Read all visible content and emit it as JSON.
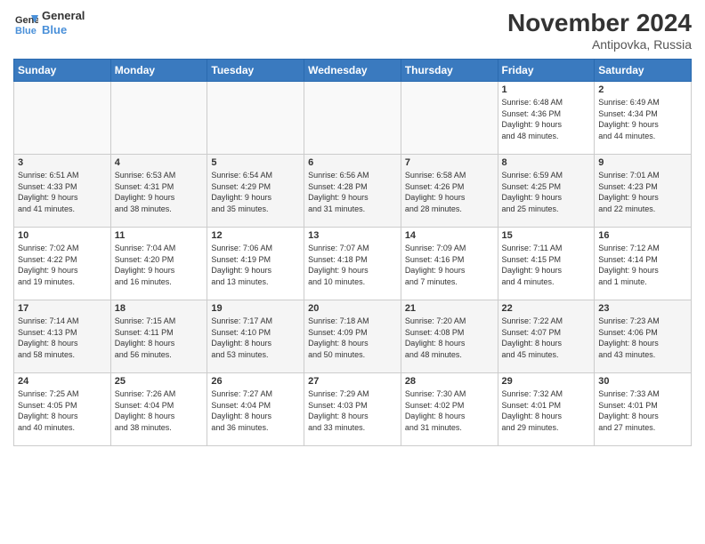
{
  "logo": {
    "line1": "General",
    "line2": "Blue"
  },
  "title": "November 2024",
  "location": "Antipovka, Russia",
  "days_header": [
    "Sunday",
    "Monday",
    "Tuesday",
    "Wednesday",
    "Thursday",
    "Friday",
    "Saturday"
  ],
  "weeks": [
    [
      {
        "day": "",
        "info": ""
      },
      {
        "day": "",
        "info": ""
      },
      {
        "day": "",
        "info": ""
      },
      {
        "day": "",
        "info": ""
      },
      {
        "day": "",
        "info": ""
      },
      {
        "day": "1",
        "info": "Sunrise: 6:48 AM\nSunset: 4:36 PM\nDaylight: 9 hours\nand 48 minutes."
      },
      {
        "day": "2",
        "info": "Sunrise: 6:49 AM\nSunset: 4:34 PM\nDaylight: 9 hours\nand 44 minutes."
      }
    ],
    [
      {
        "day": "3",
        "info": "Sunrise: 6:51 AM\nSunset: 4:33 PM\nDaylight: 9 hours\nand 41 minutes."
      },
      {
        "day": "4",
        "info": "Sunrise: 6:53 AM\nSunset: 4:31 PM\nDaylight: 9 hours\nand 38 minutes."
      },
      {
        "day": "5",
        "info": "Sunrise: 6:54 AM\nSunset: 4:29 PM\nDaylight: 9 hours\nand 35 minutes."
      },
      {
        "day": "6",
        "info": "Sunrise: 6:56 AM\nSunset: 4:28 PM\nDaylight: 9 hours\nand 31 minutes."
      },
      {
        "day": "7",
        "info": "Sunrise: 6:58 AM\nSunset: 4:26 PM\nDaylight: 9 hours\nand 28 minutes."
      },
      {
        "day": "8",
        "info": "Sunrise: 6:59 AM\nSunset: 4:25 PM\nDaylight: 9 hours\nand 25 minutes."
      },
      {
        "day": "9",
        "info": "Sunrise: 7:01 AM\nSunset: 4:23 PM\nDaylight: 9 hours\nand 22 minutes."
      }
    ],
    [
      {
        "day": "10",
        "info": "Sunrise: 7:02 AM\nSunset: 4:22 PM\nDaylight: 9 hours\nand 19 minutes."
      },
      {
        "day": "11",
        "info": "Sunrise: 7:04 AM\nSunset: 4:20 PM\nDaylight: 9 hours\nand 16 minutes."
      },
      {
        "day": "12",
        "info": "Sunrise: 7:06 AM\nSunset: 4:19 PM\nDaylight: 9 hours\nand 13 minutes."
      },
      {
        "day": "13",
        "info": "Sunrise: 7:07 AM\nSunset: 4:18 PM\nDaylight: 9 hours\nand 10 minutes."
      },
      {
        "day": "14",
        "info": "Sunrise: 7:09 AM\nSunset: 4:16 PM\nDaylight: 9 hours\nand 7 minutes."
      },
      {
        "day": "15",
        "info": "Sunrise: 7:11 AM\nSunset: 4:15 PM\nDaylight: 9 hours\nand 4 minutes."
      },
      {
        "day": "16",
        "info": "Sunrise: 7:12 AM\nSunset: 4:14 PM\nDaylight: 9 hours\nand 1 minute."
      }
    ],
    [
      {
        "day": "17",
        "info": "Sunrise: 7:14 AM\nSunset: 4:13 PM\nDaylight: 8 hours\nand 58 minutes."
      },
      {
        "day": "18",
        "info": "Sunrise: 7:15 AM\nSunset: 4:11 PM\nDaylight: 8 hours\nand 56 minutes."
      },
      {
        "day": "19",
        "info": "Sunrise: 7:17 AM\nSunset: 4:10 PM\nDaylight: 8 hours\nand 53 minutes."
      },
      {
        "day": "20",
        "info": "Sunrise: 7:18 AM\nSunset: 4:09 PM\nDaylight: 8 hours\nand 50 minutes."
      },
      {
        "day": "21",
        "info": "Sunrise: 7:20 AM\nSunset: 4:08 PM\nDaylight: 8 hours\nand 48 minutes."
      },
      {
        "day": "22",
        "info": "Sunrise: 7:22 AM\nSunset: 4:07 PM\nDaylight: 8 hours\nand 45 minutes."
      },
      {
        "day": "23",
        "info": "Sunrise: 7:23 AM\nSunset: 4:06 PM\nDaylight: 8 hours\nand 43 minutes."
      }
    ],
    [
      {
        "day": "24",
        "info": "Sunrise: 7:25 AM\nSunset: 4:05 PM\nDaylight: 8 hours\nand 40 minutes."
      },
      {
        "day": "25",
        "info": "Sunrise: 7:26 AM\nSunset: 4:04 PM\nDaylight: 8 hours\nand 38 minutes."
      },
      {
        "day": "26",
        "info": "Sunrise: 7:27 AM\nSunset: 4:04 PM\nDaylight: 8 hours\nand 36 minutes."
      },
      {
        "day": "27",
        "info": "Sunrise: 7:29 AM\nSunset: 4:03 PM\nDaylight: 8 hours\nand 33 minutes."
      },
      {
        "day": "28",
        "info": "Sunrise: 7:30 AM\nSunset: 4:02 PM\nDaylight: 8 hours\nand 31 minutes."
      },
      {
        "day": "29",
        "info": "Sunrise: 7:32 AM\nSunset: 4:01 PM\nDaylight: 8 hours\nand 29 minutes."
      },
      {
        "day": "30",
        "info": "Sunrise: 7:33 AM\nSunset: 4:01 PM\nDaylight: 8 hours\nand 27 minutes."
      }
    ]
  ]
}
